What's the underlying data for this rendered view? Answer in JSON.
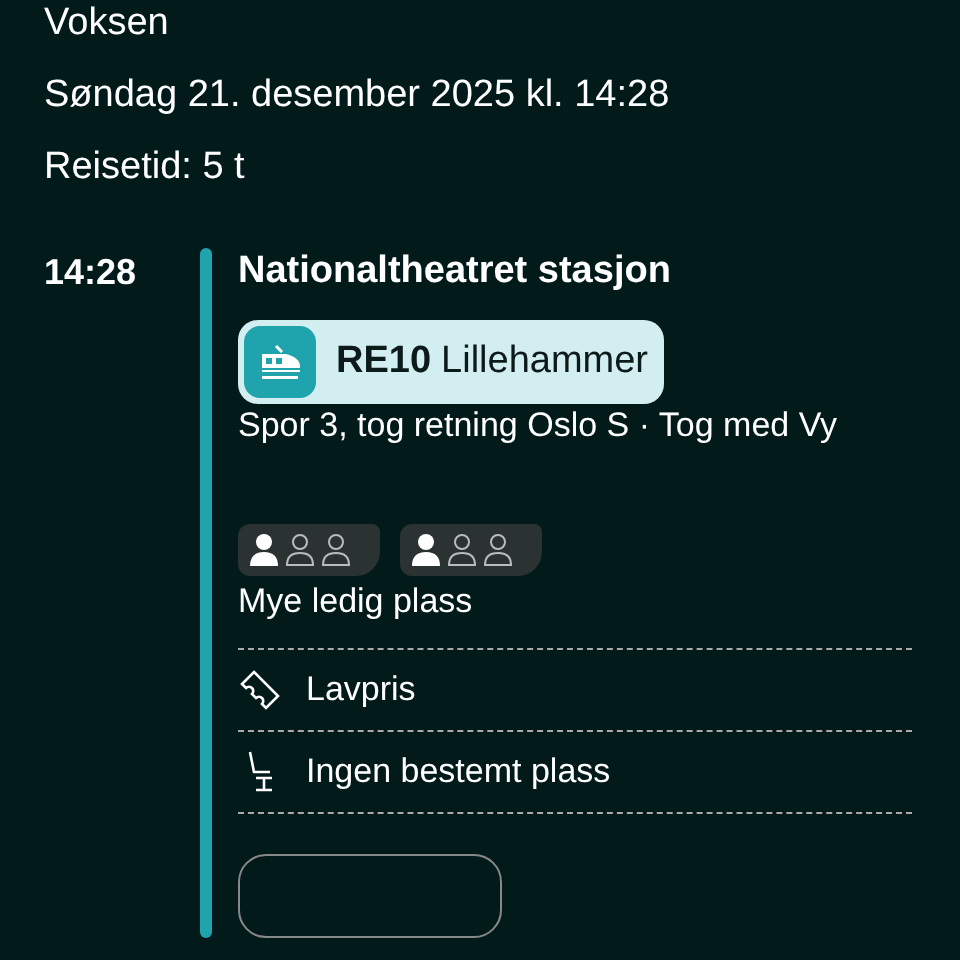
{
  "passenger": "Voksen",
  "departure": "Søndag 21. desember 2025 kl. 14:28",
  "travel_time": "Reisetid: 5 t",
  "leg": {
    "time": "14:28",
    "stop": "Nationaltheatret stasjon",
    "line": {
      "code": "RE10",
      "destination": "Lillehammer"
    },
    "platform_info": "Spor 3, tog retning Oslo S · Tog med Vy",
    "occupancy": [
      {
        "persons": [
          {
            "filled": true
          },
          {
            "filled": false
          },
          {
            "filled": false
          }
        ]
      },
      {
        "persons": [
          {
            "filled": true
          },
          {
            "filled": false
          },
          {
            "filled": false
          }
        ]
      }
    ],
    "occupancy_label": "Mye ledig plass",
    "features": [
      {
        "kind": "ticket",
        "label": "Lavpris"
      },
      {
        "kind": "seat",
        "label": "Ingen bestemt plass"
      }
    ]
  }
}
